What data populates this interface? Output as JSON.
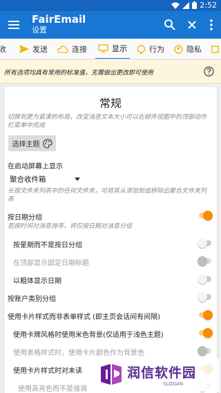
{
  "status": {
    "time": "2:52"
  },
  "appbar": {
    "title": "FairEmail",
    "subtitle": "设置"
  },
  "tabs": [
    {
      "label": "收"
    },
    {
      "label": "发送"
    },
    {
      "label": "连接"
    },
    {
      "label": "显示"
    },
    {
      "label": "行为"
    },
    {
      "label": "隐私"
    }
  ],
  "hint": {
    "text": "所有选项均具有常用的标准值，无需做出更改即可使用"
  },
  "card": {
    "title": "常规",
    "compact_hint": "切换到更为紧凑的布局，改变消息文本大小可以在邮件视图中的顶部动作栏菜单中完成",
    "theme_button": "选择主题",
    "startup_label": "在启动屏幕上显示",
    "startup_value": "聚合收件箱",
    "startup_hint": "长按文件夹列表中的任何文件夹，可将其从添加到或移除出聚合文件夹列表",
    "settings": [
      {
        "label": "按日期分组",
        "state": "on"
      },
      {
        "label": "按星期而不是按日分组",
        "state": "off"
      },
      {
        "label": "在顶部显示固定日期标题",
        "state": "disabled"
      },
      {
        "label": "以粗体显示日期",
        "state": "off"
      },
      {
        "label": "按账户类别分组",
        "state": "off"
      },
      {
        "label": "使用卡片样式而非表单样式 (即主页会话间有间隔)",
        "state": "on"
      },
      {
        "label": "使用卡牌风格时使用米色背景(仅适用于浅色主题)",
        "state": "on"
      },
      {
        "label": "使用表格样式时，使用卡片颜色作为背景色",
        "state": "disabled"
      },
      {
        "label": "使用卡片样式时对未读",
        "state": "on"
      },
      {
        "label": "使用高亮色而不是强调",
        "state": "off"
      }
    ],
    "group_hint": "若按时间对消息排序，将仅按日期对消息分组"
  },
  "watermark": {
    "name": "润信软件园",
    "slogan": "SLOGAN"
  }
}
